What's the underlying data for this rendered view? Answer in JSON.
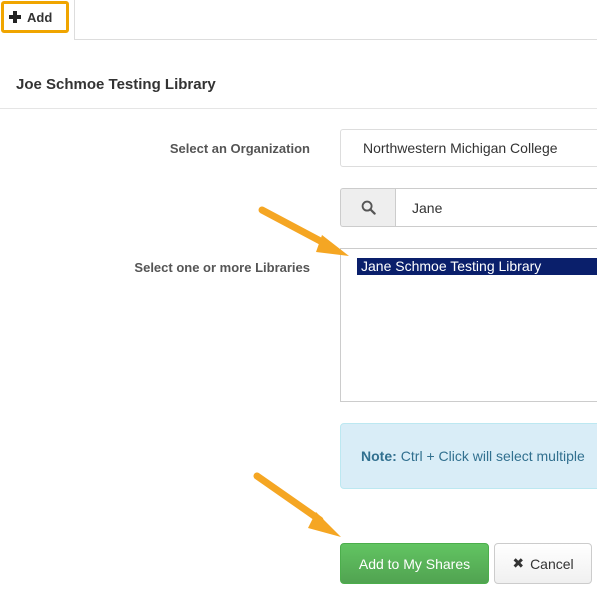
{
  "tabs": {
    "add_label": "Add"
  },
  "panel": {
    "title": "Joe Schmoe Testing Library"
  },
  "form": {
    "organization_label": "Select an Organization",
    "organization_value": "Northwestern Michigan College",
    "search_value": "Jane",
    "libraries_label": "Select one or more Libraries",
    "libraries_options": [
      {
        "label": "Jane Schmoe Testing Library",
        "selected": true
      }
    ]
  },
  "note": {
    "prefix": "Note:",
    "text": "Ctrl + Click will select multiple"
  },
  "actions": {
    "submit_label": "Add to My Shares",
    "cancel_label": "Cancel"
  },
  "colors": {
    "highlight_border": "#f0a500",
    "arrow": "#f5a623",
    "selected_option_bg": "#0a1f6b",
    "success_button": "#5cb85c",
    "note_bg": "#d9edf7"
  },
  "icons": {
    "add": "plus-icon",
    "search": "search-icon",
    "cancel": "close-icon"
  }
}
